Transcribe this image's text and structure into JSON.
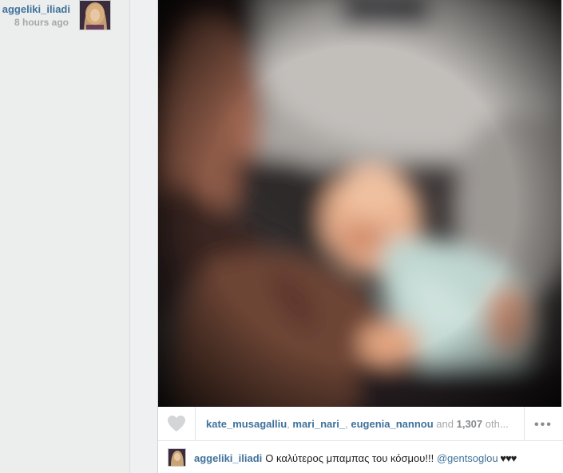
{
  "post": {
    "author": "aggeliki_iliadi",
    "time_ago": "8 hours ago"
  },
  "likes": {
    "users": [
      "kate_musagalliu",
      "mari_nari_",
      "eugenia_nannou"
    ],
    "separator": ", ",
    "and_text": " and ",
    "count": "1,307",
    "others_text": " oth..."
  },
  "caption": {
    "author": "aggeliki_iliadi",
    "text": "Ο καλύτερος μπαμπας του κόσμου!!! ",
    "mention": "@gentsoglou",
    "hearts": " ♥♥♥"
  },
  "icons": {
    "like": "heart-icon",
    "more": "more-options-icon",
    "avatar": "user-avatar"
  },
  "colors": {
    "link": "#3f729b",
    "muted": "#a5a7aa",
    "background": "#edeeef"
  }
}
